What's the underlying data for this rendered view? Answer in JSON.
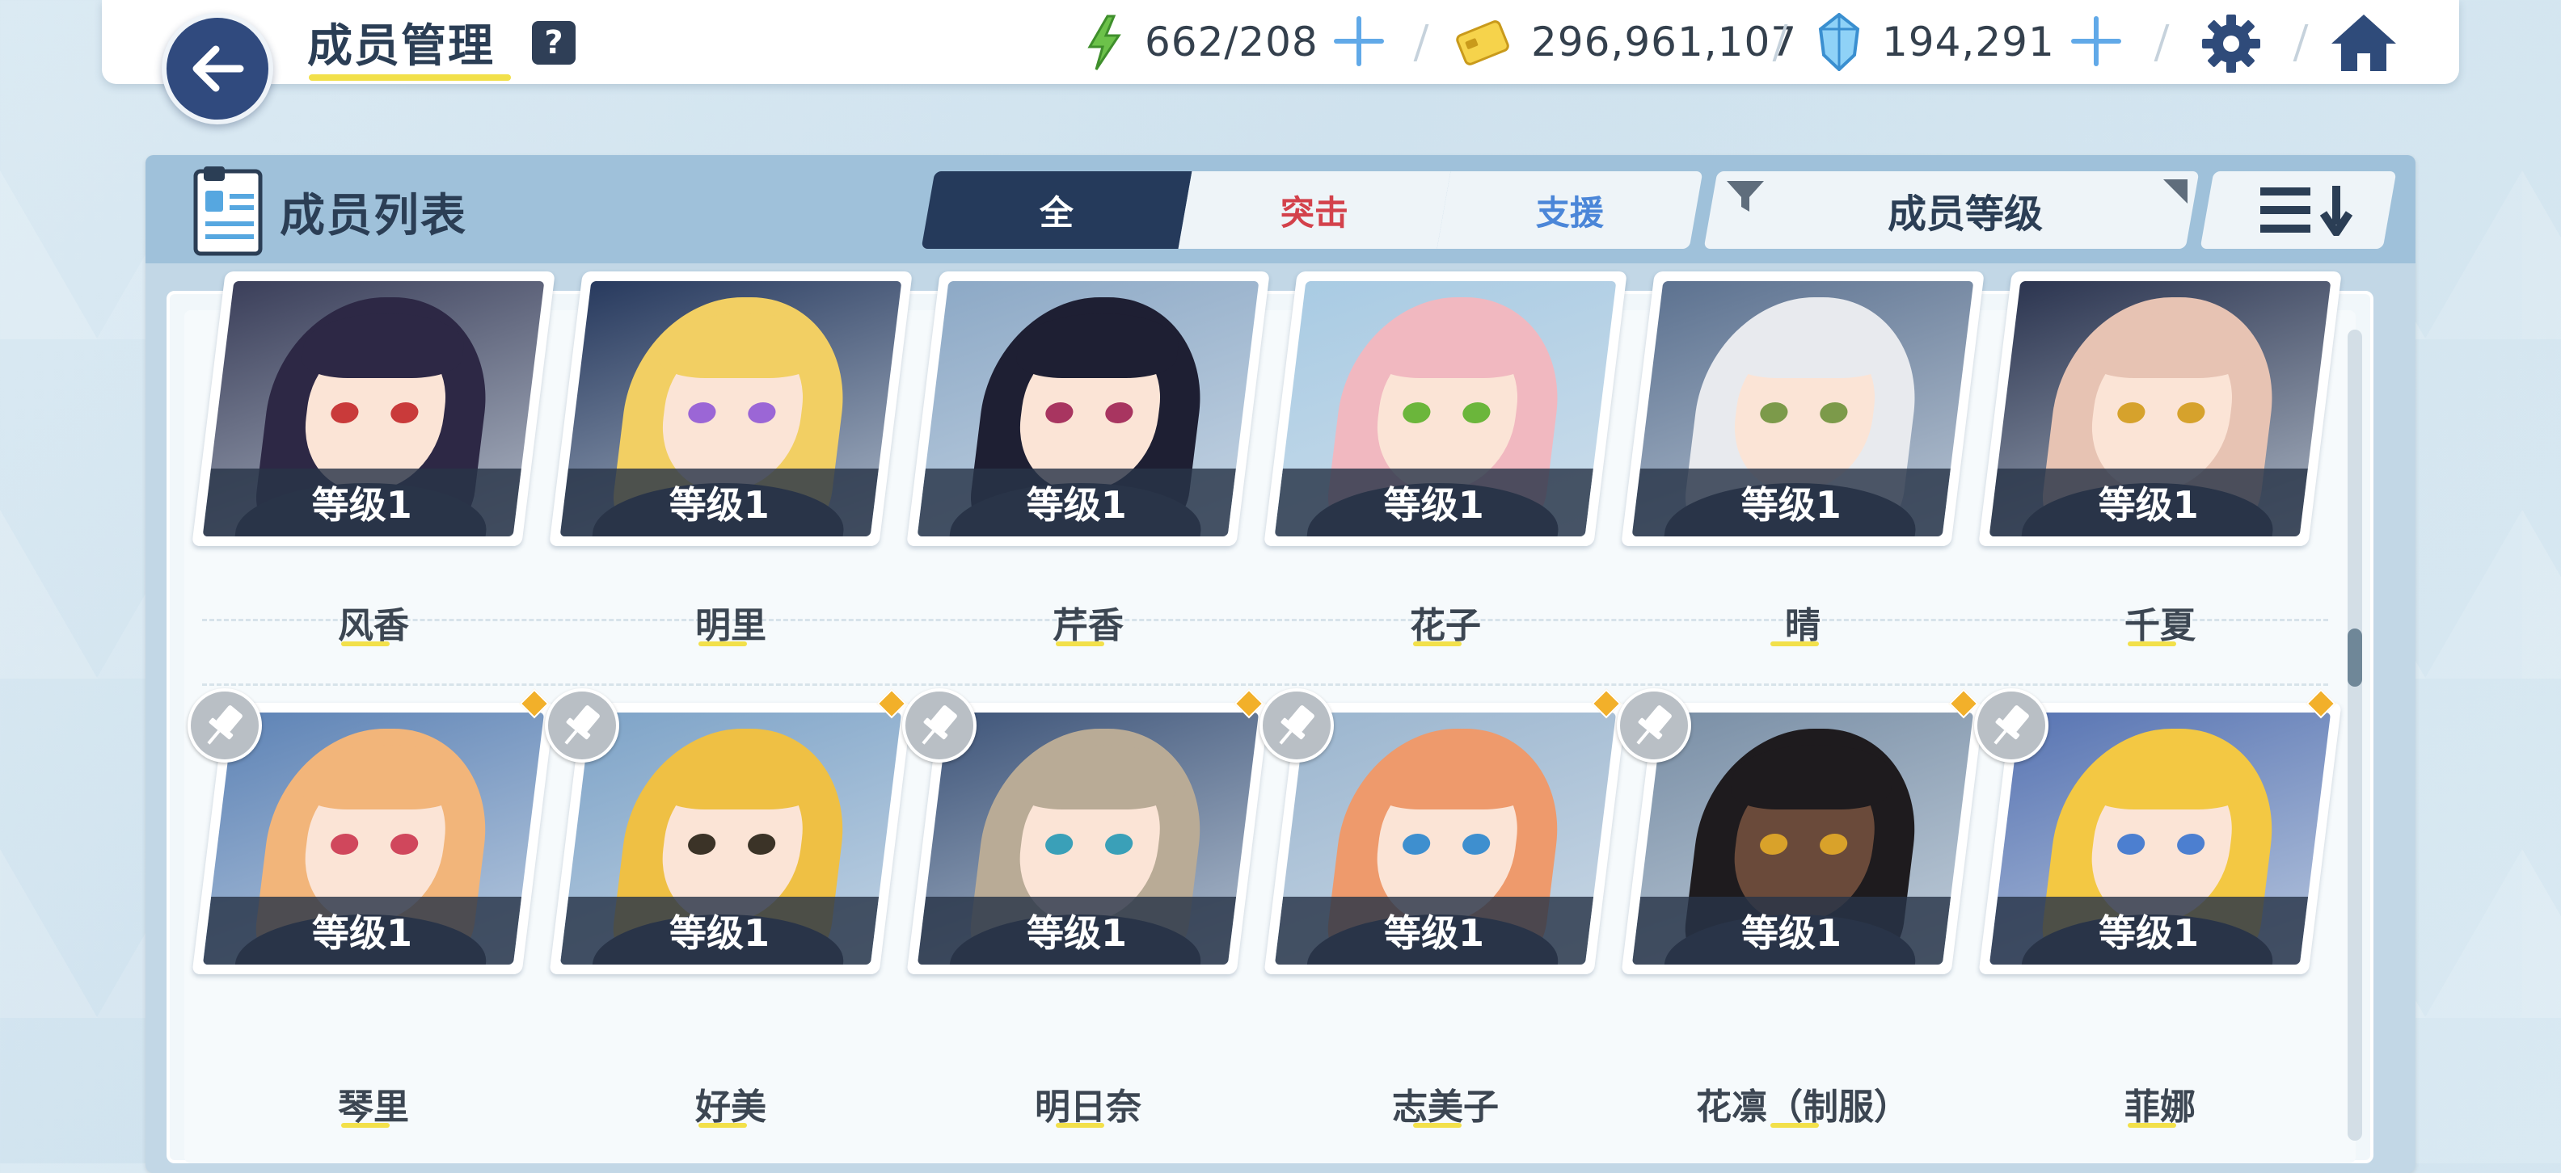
{
  "header": {
    "title": "成员管理",
    "help_label": "?",
    "ap": "662/208",
    "credits": "296,961,107",
    "gems": "194,291"
  },
  "panel": {
    "title": "成员列表",
    "tabs": [
      {
        "label": "全",
        "active": true
      },
      {
        "label": "突击",
        "active": false
      },
      {
        "label": "支援",
        "active": false
      }
    ],
    "sort_label": "成员等级"
  },
  "rows": [
    {
      "cards": [
        {
          "name": "风香",
          "level": "等级1",
          "hair": "#2d2845",
          "bg": "#3b3f5a",
          "eye": "#c93a3a"
        },
        {
          "name": "明里",
          "level": "等级1",
          "hair": "#f2cf63",
          "bg": "#283a5e",
          "eye": "#9b66d6"
        },
        {
          "name": "芹香",
          "level": "等级1",
          "hair": "#1e1f33",
          "bg": "#8da9c6",
          "eye": "#a83560"
        },
        {
          "name": "花子",
          "level": "等级1",
          "hair": "#f1b8c0",
          "bg": "#a9cbe3",
          "eye": "#6bb63b"
        },
        {
          "name": "晴",
          "level": "等级1",
          "hair": "#e8eaee",
          "bg": "#5d7290",
          "eye": "#7c9a4a"
        },
        {
          "name": "千夏",
          "level": "等级1",
          "hair": "#e7c3b3",
          "bg": "#2c3550",
          "eye": "#d6a22c"
        }
      ]
    },
    {
      "cards": [
        {
          "name": "琴里",
          "level": "等级1",
          "hair": "#f2b57a",
          "bg": "#5f84b6",
          "eye": "#d0475c"
        },
        {
          "name": "好美",
          "level": "等级1",
          "hair": "#efc044",
          "bg": "#7fa4c8",
          "eye": "#3b3327"
        },
        {
          "name": "明日奈",
          "level": "等级1",
          "hair": "#b9ab96",
          "bg": "#40567a",
          "eye": "#3aa0b8"
        },
        {
          "name": "志美子",
          "level": "等级1",
          "hair": "#ee9a6c",
          "bg": "#9cb6cf",
          "eye": "#3e8fcf"
        },
        {
          "name": "花凛（制服）",
          "level": "等级1",
          "hair": "#1e1b1e",
          "bg": "#7a8fa6",
          "eye": "#d9a22a"
        },
        {
          "name": "菲娜",
          "level": "等级1",
          "hair": "#f3c843",
          "bg": "#5975b3",
          "eye": "#4c7fd0"
        }
      ]
    }
  ],
  "icons": {
    "back": "back-arrow-icon",
    "ap": "lightning-icon",
    "credits": "credit-card-icon",
    "gems": "crystal-icon",
    "settings": "gear-icon",
    "home": "home-icon",
    "filter": "funnel-icon",
    "sort_order": "sort-descending-icon",
    "pin": "pin-icon"
  }
}
